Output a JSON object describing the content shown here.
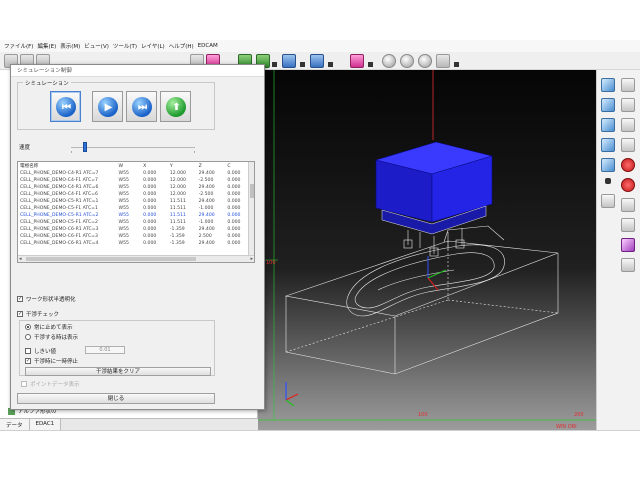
{
  "menu": [
    "ファイル(F)",
    "編集(E)",
    "表示(M)",
    "ビュー(V)",
    "ツール(T)",
    "レイヤ(L)",
    "ヘルプ(H)",
    "EDCAM"
  ],
  "dialog": {
    "title": "シミュレーション制御",
    "simulation_group": "シミュレーション",
    "speed_label": "速度",
    "list": {
      "headers": [
        "電極名称",
        "W",
        "X",
        "Y",
        "Z",
        "C"
      ],
      "rows": [
        [
          "CELL_PHONE_DEMO-C4-R1 ATC=7",
          "W55",
          "0.000",
          "12.000",
          "29.400",
          "0.000"
        ],
        [
          "CELL_PHONE_DEMO-C4-F1 ATC=7",
          "W55",
          "0.000",
          "12.000",
          "-2.500",
          "0.000"
        ],
        [
          "CELL_PHONE_DEMO-C4-R1 ATC=6",
          "W55",
          "0.000",
          "12.000",
          "29.400",
          "0.000"
        ],
        [
          "CELL_PHONE_DEMO-C4-F1 ATC=6",
          "W55",
          "0.000",
          "12.000",
          "-2.500",
          "0.000"
        ],
        [
          "CELL_PHONE_DEMO-C5-R1 ATC=1",
          "W55",
          "0.000",
          "11.511",
          "29.400",
          "0.000"
        ],
        [
          "CELL_PHONE_DEMO-C5-F1 ATC=1",
          "W55",
          "0.000",
          "11.511",
          "-1.000",
          "0.000"
        ],
        [
          "CELL_PHONE_DEMO-C5-R1 ATC=2",
          "W55",
          "0.000",
          "11.511",
          "29.400",
          "0.000"
        ],
        [
          "CELL_PHONE_DEMO-C5-F1 ATC=2",
          "W55",
          "0.000",
          "11.511",
          "-1.000",
          "0.000"
        ],
        [
          "CELL_PHONE_DEMO-C6-R1 ATC=3",
          "W55",
          "0.000",
          "-1.359",
          "29.400",
          "0.000"
        ],
        [
          "CELL_PHONE_DEMO-C6-F1 ATC=3",
          "W55",
          "0.000",
          "-1.359",
          "2.500",
          "0.000"
        ],
        [
          "CELL_PHONE_DEMO-C6-R1 ATC=4",
          "W55",
          "0.000",
          "-1.359",
          "29.400",
          "0.000"
        ]
      ]
    },
    "work_transparent": "ワーク形状半透明化",
    "interference_check": "干渉チェック",
    "radio_stop_always": "常に止めて表示",
    "radio_stop_on_hit": "干渉する時は表示",
    "threshold_label": "しきい値",
    "threshold_value": "0.01",
    "pause_on_interference": "干渉時に一時停止",
    "clear_results_button": "干渉結果をクリア",
    "point_only": "ポイントデータ表示",
    "close_button": "閉じる"
  },
  "left_panel": {
    "tree_item": "アルファ形状の"
  },
  "bottom_tabs": [
    "データ",
    "EDAC1"
  ],
  "viewport": {
    "axis_label_left": "100",
    "axis_label_mid": "100",
    "axis_label_right": "200",
    "corner_label": "WIN ORI"
  }
}
